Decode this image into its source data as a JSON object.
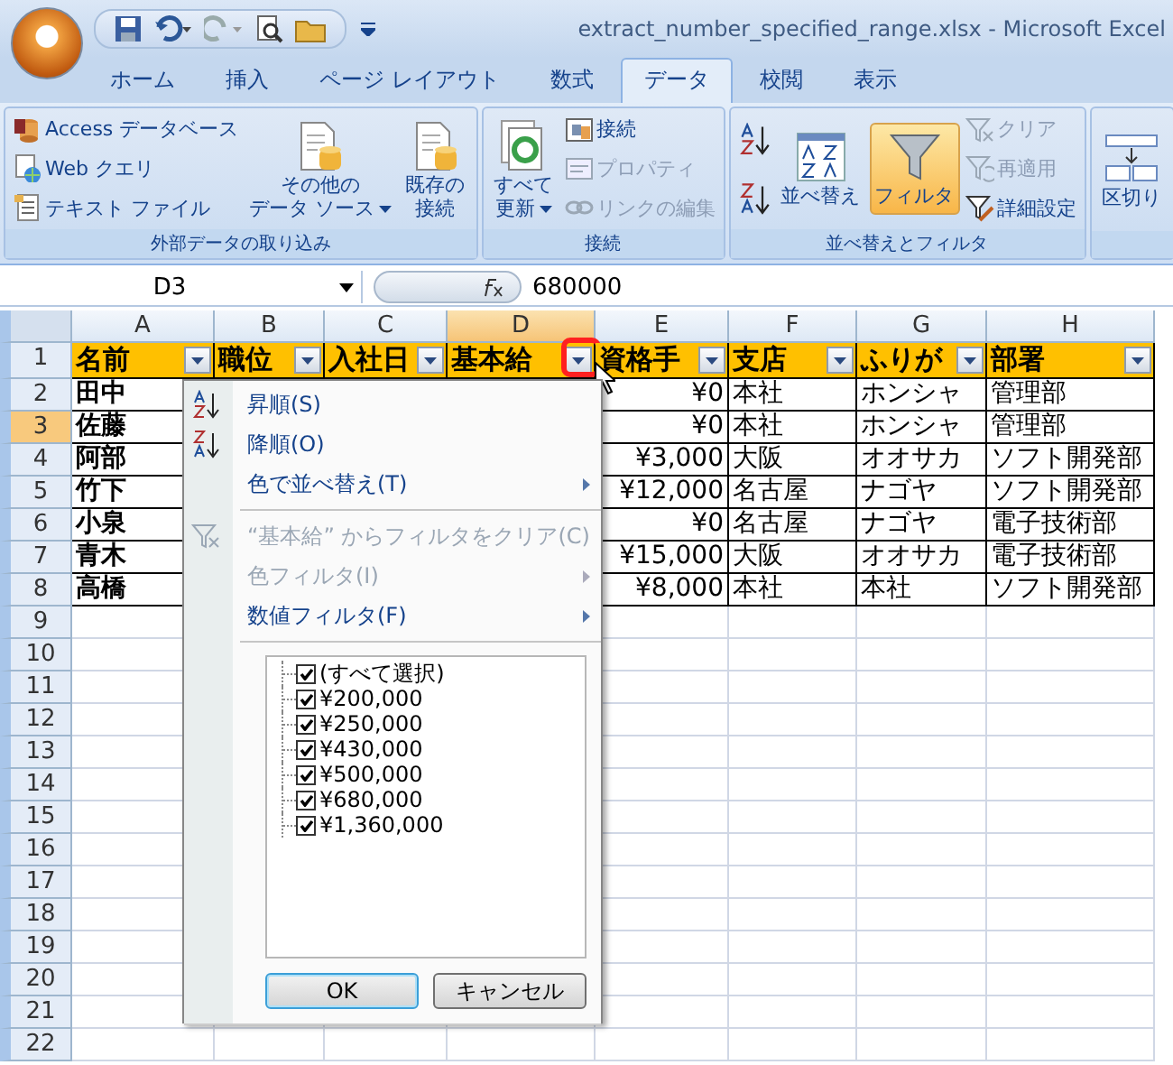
{
  "title_bar": {
    "title": "extract_number_specified_range.xlsx - Microsoft Excel"
  },
  "ribbon": {
    "tabs": [
      {
        "label": "ホーム",
        "selected": false
      },
      {
        "label": "挿入",
        "selected": false
      },
      {
        "label": "ページ レイアウト",
        "selected": false
      },
      {
        "label": "数式",
        "selected": false
      },
      {
        "label": "データ",
        "selected": true
      },
      {
        "label": "校閲",
        "selected": false
      },
      {
        "label": "表示",
        "selected": false
      }
    ],
    "groups": [
      {
        "label": "外部データの取り込み",
        "columns": [
          [
            {
              "kind": "small",
              "label": "Access データベース",
              "disabled": false
            },
            {
              "kind": "small",
              "label": "Web クエリ",
              "disabled": false
            },
            {
              "kind": "small",
              "label": "テキスト ファイル",
              "disabled": false
            }
          ],
          [
            {
              "kind": "large",
              "lines": [
                "その他の",
                "データ ソース"
              ],
              "disabled": false,
              "dropdown": true
            }
          ],
          [
            {
              "kind": "large",
              "lines": [
                "既存の",
                "接続"
              ],
              "disabled": false
            }
          ]
        ]
      },
      {
        "label": "接続",
        "columns": [
          [
            {
              "kind": "large",
              "lines": [
                "すべて",
                "更新"
              ],
              "disabled": false,
              "dropdown": true
            }
          ],
          [
            {
              "kind": "small",
              "label": "接続",
              "disabled": false
            },
            {
              "kind": "small",
              "label": "プロパティ",
              "disabled": true
            },
            {
              "kind": "small",
              "label": "リンクの編集",
              "disabled": true
            }
          ]
        ]
      },
      {
        "label": "並べ替えとフィルタ",
        "columns": [
          [
            {
              "kind": "icon",
              "disabled": false
            },
            {
              "kind": "icon",
              "disabled": false
            }
          ],
          [
            {
              "kind": "large",
              "lines": [
                "並べ替え"
              ],
              "disabled": false
            }
          ],
          [
            {
              "kind": "large",
              "lines": [
                "フィルタ"
              ],
              "disabled": false,
              "on": true
            }
          ],
          [
            {
              "kind": "small",
              "label": "クリア",
              "disabled": true
            },
            {
              "kind": "small",
              "label": "再適用",
              "disabled": true
            },
            {
              "kind": "small",
              "label": "詳細設定",
              "disabled": false
            }
          ]
        ]
      },
      {
        "columns": [
          [
            {
              "kind": "large",
              "lines": [
                "区切り"
              ],
              "disabled": false
            }
          ]
        ]
      }
    ]
  },
  "formula_bar": {
    "name_box": "D3",
    "value": "680000"
  },
  "sheet": {
    "columns": [
      {
        "label": "A",
        "selected": false
      },
      {
        "label": "B",
        "selected": false
      },
      {
        "label": "C",
        "selected": false
      },
      {
        "label": "D",
        "selected": true
      },
      {
        "label": "E",
        "selected": false
      },
      {
        "label": "F",
        "selected": false
      },
      {
        "label": "G",
        "selected": false
      },
      {
        "label": "H",
        "selected": false
      }
    ],
    "header_row": {
      "number": "1",
      "selected": false,
      "cells": [
        {
          "text": "名前",
          "highlighted": false
        },
        {
          "text": "職位",
          "highlighted": false
        },
        {
          "text": "入社日",
          "highlighted": false
        },
        {
          "text": "基本給",
          "highlighted": true
        },
        {
          "text": "資格手",
          "highlighted": false
        },
        {
          "text": "支店",
          "highlighted": false
        },
        {
          "text": "ふりが",
          "highlighted": false
        },
        {
          "text": "部署",
          "highlighted": false
        }
      ]
    },
    "rows": [
      {
        "number": "2",
        "selected": false,
        "name": "田中",
        "values": [
          "¥0",
          "本社",
          "ホンシャ",
          "管理部"
        ]
      },
      {
        "number": "3",
        "selected": true,
        "name": "佐藤",
        "values": [
          "¥0",
          "本社",
          "ホンシャ",
          "管理部"
        ]
      },
      {
        "number": "4",
        "selected": false,
        "name": "阿部",
        "values": [
          "¥3,000",
          "大阪",
          "オオサカ",
          "ソフト開発部"
        ]
      },
      {
        "number": "5",
        "selected": false,
        "name": "竹下",
        "values": [
          "¥12,000",
          "名古屋",
          "ナゴヤ",
          "ソフト開発部"
        ]
      },
      {
        "number": "6",
        "selected": false,
        "name": "小泉",
        "values": [
          "¥0",
          "名古屋",
          "ナゴヤ",
          "電子技術部"
        ]
      },
      {
        "number": "7",
        "selected": false,
        "name": "青木",
        "values": [
          "¥15,000",
          "大阪",
          "オオサカ",
          "電子技術部"
        ]
      },
      {
        "number": "8",
        "selected": false,
        "name": "高橋",
        "values": [
          "¥8,000",
          "本社",
          "本社",
          "ソフト開発部"
        ]
      }
    ],
    "empty_rows": [
      "9",
      "10",
      "11",
      "12",
      "13",
      "14",
      "15",
      "16",
      "17",
      "18",
      "19",
      "20",
      "21",
      "22"
    ]
  },
  "filter_menu": {
    "items": [
      {
        "kind": "item",
        "label": "昇順(S)",
        "disabled": false,
        "submenu": false
      },
      {
        "kind": "item",
        "label": "降順(O)",
        "disabled": false,
        "submenu": false
      },
      {
        "kind": "item",
        "label": "色で並べ替え(T)",
        "disabled": false,
        "submenu": true
      },
      {
        "kind": "separator"
      },
      {
        "kind": "item",
        "label": "“基本給” からフィルタをクリア(C)",
        "disabled": true,
        "submenu": false
      },
      {
        "kind": "item",
        "label": "色フィルタ(I)",
        "disabled": true,
        "submenu": true
      },
      {
        "kind": "item",
        "label": "数値フィルタ(F)",
        "disabled": false,
        "submenu": true
      },
      {
        "kind": "separator"
      }
    ],
    "values": [
      {
        "label": "(すべて選択)",
        "checked": true
      },
      {
        "label": "¥200,000",
        "checked": true
      },
      {
        "label": "¥250,000",
        "checked": true
      },
      {
        "label": "¥430,000",
        "checked": true
      },
      {
        "label": "¥500,000",
        "checked": true
      },
      {
        "label": "¥680,000",
        "checked": true
      },
      {
        "label": "¥1,360,000",
        "checked": true
      }
    ],
    "buttons": [
      {
        "label": "OK",
        "default": true
      },
      {
        "label": "キャンセル",
        "default": false
      }
    ]
  }
}
